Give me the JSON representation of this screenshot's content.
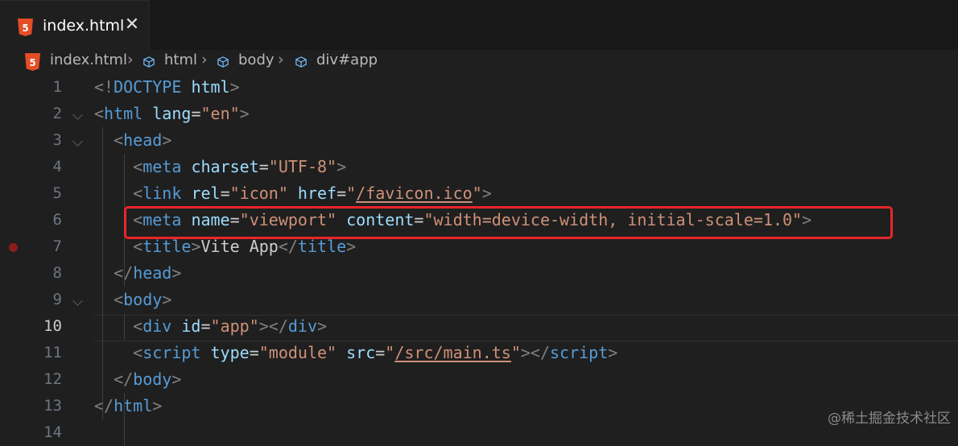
{
  "tab": {
    "filename": "index.html",
    "close_glyph": "✕",
    "file_icon": "html5-icon"
  },
  "breadcrumb": {
    "items": [
      "index.html",
      "html",
      "body",
      "div#app"
    ]
  },
  "editor": {
    "line_numbers": [
      "1",
      "2",
      "3",
      "4",
      "5",
      "6",
      "7",
      "8",
      "9",
      "10",
      "11",
      "12",
      "13",
      "14"
    ],
    "current_line": "10",
    "highlight_color": "#e8262b",
    "lines": [
      [
        [
          "g",
          "<!"
        ],
        [
          "t",
          "DOCTYPE"
        ],
        [
          "x",
          " "
        ],
        [
          "a",
          "html"
        ],
        [
          "g",
          ">"
        ]
      ],
      [
        [
          "g",
          "<"
        ],
        [
          "t",
          "html"
        ],
        [
          "x",
          " "
        ],
        [
          "a",
          "lang"
        ],
        [
          "x",
          "="
        ],
        [
          "s",
          "\"en\""
        ],
        [
          "g",
          ">"
        ]
      ],
      [
        [
          "x",
          "  "
        ],
        [
          "g",
          "<"
        ],
        [
          "t",
          "head"
        ],
        [
          "g",
          ">"
        ]
      ],
      [
        [
          "x",
          "    "
        ],
        [
          "g",
          "<"
        ],
        [
          "t",
          "meta"
        ],
        [
          "x",
          " "
        ],
        [
          "a",
          "charset"
        ],
        [
          "x",
          "="
        ],
        [
          "s",
          "\"UTF-8\""
        ],
        [
          "g",
          ">"
        ]
      ],
      [
        [
          "x",
          "    "
        ],
        [
          "g",
          "<"
        ],
        [
          "t",
          "link"
        ],
        [
          "x",
          " "
        ],
        [
          "a",
          "rel"
        ],
        [
          "x",
          "="
        ],
        [
          "s",
          "\"icon\""
        ],
        [
          "x",
          " "
        ],
        [
          "a",
          "href"
        ],
        [
          "x",
          "="
        ],
        [
          "s",
          "\""
        ],
        [
          "su",
          "/favicon.ico"
        ],
        [
          "s",
          "\""
        ],
        [
          "g",
          ">"
        ]
      ],
      [
        [
          "x",
          "    "
        ],
        [
          "g",
          "<"
        ],
        [
          "t",
          "meta"
        ],
        [
          "x",
          " "
        ],
        [
          "a",
          "name"
        ],
        [
          "x",
          "="
        ],
        [
          "s",
          "\"viewport\""
        ],
        [
          "x",
          " "
        ],
        [
          "a",
          "content"
        ],
        [
          "x",
          "="
        ],
        [
          "s",
          "\"width=device-width, initial-scale=1.0\""
        ],
        [
          "g",
          ">"
        ]
      ],
      [
        [
          "x",
          "    "
        ],
        [
          "g",
          "<"
        ],
        [
          "t",
          "title"
        ],
        [
          "g",
          ">"
        ],
        [
          "x",
          "Vite App"
        ],
        [
          "g",
          "</"
        ],
        [
          "t",
          "title"
        ],
        [
          "g",
          ">"
        ]
      ],
      [
        [
          "x",
          "  "
        ],
        [
          "g",
          "</"
        ],
        [
          "t",
          "head"
        ],
        [
          "g",
          ">"
        ]
      ],
      [
        [
          "x",
          "  "
        ],
        [
          "g",
          "<"
        ],
        [
          "t",
          "body"
        ],
        [
          "g",
          ">"
        ]
      ],
      [
        [
          "x",
          "    "
        ],
        [
          "g",
          "<"
        ],
        [
          "t",
          "div"
        ],
        [
          "x",
          " "
        ],
        [
          "a",
          "id"
        ],
        [
          "x",
          "="
        ],
        [
          "s",
          "\"app\""
        ],
        [
          "g",
          "></"
        ],
        [
          "t",
          "div"
        ],
        [
          "g",
          ">"
        ]
      ],
      [
        [
          "x",
          "    "
        ],
        [
          "g",
          "<"
        ],
        [
          "t",
          "script"
        ],
        [
          "x",
          " "
        ],
        [
          "a",
          "type"
        ],
        [
          "x",
          "="
        ],
        [
          "s",
          "\"module\""
        ],
        [
          "x",
          " "
        ],
        [
          "a",
          "src"
        ],
        [
          "x",
          "="
        ],
        [
          "s",
          "\""
        ],
        [
          "su",
          "/src/main.ts"
        ],
        [
          "s",
          "\""
        ],
        [
          "g",
          "></"
        ],
        [
          "t",
          "script"
        ],
        [
          "g",
          ">"
        ]
      ],
      [
        [
          "x",
          "  "
        ],
        [
          "g",
          "</"
        ],
        [
          "t",
          "body"
        ],
        [
          "g",
          ">"
        ]
      ],
      [
        [
          "g",
          "</"
        ],
        [
          "t",
          "html"
        ],
        [
          "g",
          ">"
        ]
      ],
      []
    ],
    "folds": [
      "2",
      "3",
      "9"
    ]
  },
  "watermark": "@稀土掘金技术社区"
}
